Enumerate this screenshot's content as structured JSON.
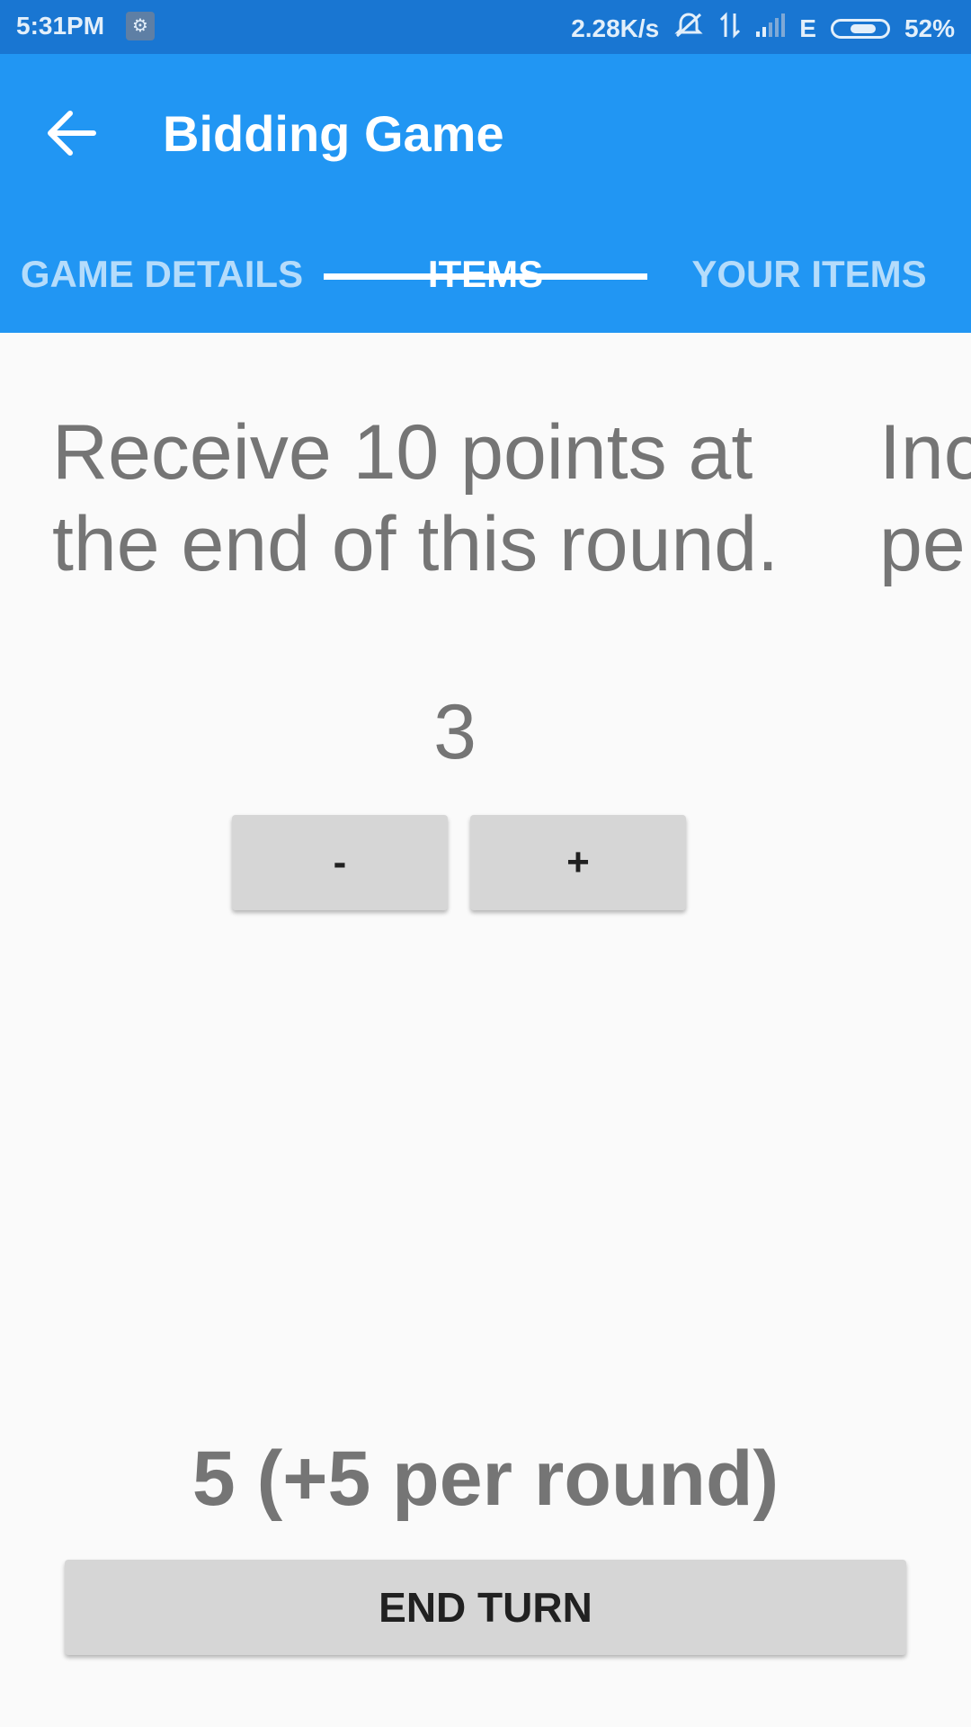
{
  "status_bar": {
    "time": "5:31PM",
    "network_speed": "2.28K/s",
    "network_type": "E",
    "battery_percent": "52%",
    "battery_level": 0.52,
    "icons": [
      "notification-icon",
      "mute-icon",
      "data-transfer-icon",
      "signal-icon",
      "battery-icon"
    ]
  },
  "app_bar": {
    "title": "Bidding Game",
    "background": "#2196f3",
    "status_background": "#1976d2"
  },
  "tabs": [
    {
      "label": "GAME DETAILS",
      "active": false
    },
    {
      "label": "ITEMS",
      "active": true
    },
    {
      "label": "YOUR ITEMS",
      "active": false
    }
  ],
  "item": {
    "description": "Receive 10 points at the end of this round.",
    "next_description_partial": "Inc\npe",
    "bid_amount": "3",
    "decrement_label": "-",
    "increment_label": "+"
  },
  "footer": {
    "points_summary": "5 (+5 per round)",
    "end_turn_label": "END TURN"
  }
}
